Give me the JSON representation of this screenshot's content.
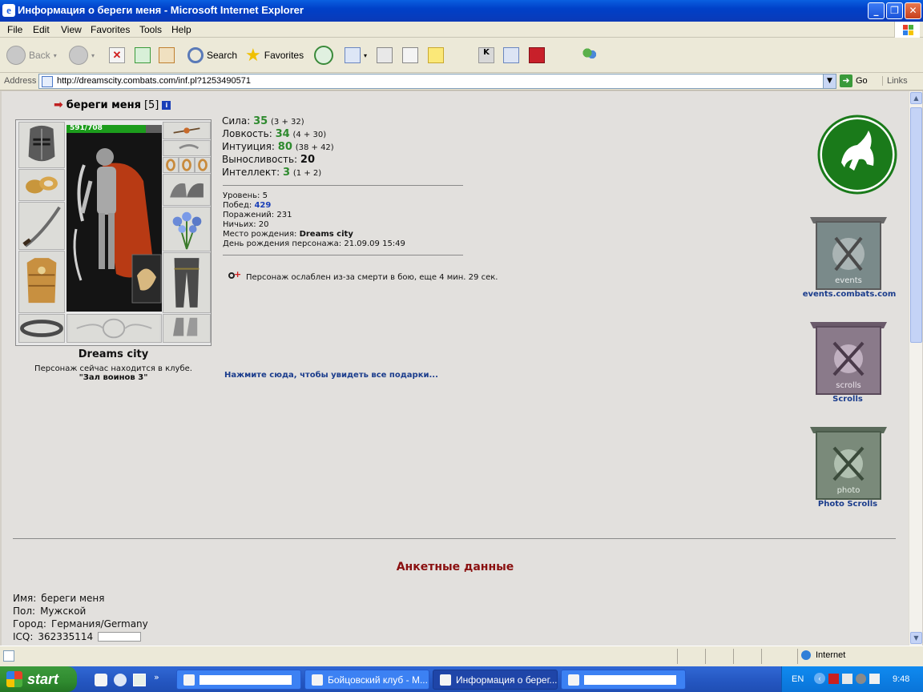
{
  "window": {
    "title": "Информация о береги меня - Microsoft Internet Explorer",
    "minimize": "_",
    "maximize": "❐",
    "close": "✕"
  },
  "menu": [
    "File",
    "Edit",
    "View",
    "Favorites",
    "Tools",
    "Help"
  ],
  "toolbar": {
    "back": "Back",
    "search": "Search",
    "favorites": "Favorites"
  },
  "address": {
    "label": "Address",
    "url": "http://dreamscity.combats.com/inf.pl?1253490571",
    "go": "Go",
    "links": "Links"
  },
  "character": {
    "name": "береги меня",
    "level": "[5]",
    "hp_text": "591/708",
    "hp_fraction": 0.835,
    "city": "Dreams city",
    "location_line": "Персонаж сейчас находится в клубе.",
    "location_room": "\"Зал воинов 3\""
  },
  "stats": [
    {
      "label": "Сила:",
      "value": "35",
      "detail": "(3 + 32)"
    },
    {
      "label": "Ловкость:",
      "value": "34",
      "detail": "(4 + 30)"
    },
    {
      "label": "Интуиция:",
      "value": "80",
      "detail": "(38 + 42)"
    },
    {
      "label": "Выносливость:",
      "value": "20",
      "detail": ""
    },
    {
      "label": "Интеллект:",
      "value": "3",
      "detail": "(1 + 2)"
    }
  ],
  "details": {
    "level_label": "Уровень:",
    "level": "5",
    "wins_label": "Побед:",
    "wins": "429",
    "losses_label": "Поражений:",
    "losses": "231",
    "draws_label": "Ничьих:",
    "draws": "20",
    "birthplace_label": "Место рождения:",
    "birthplace": "Dreams city",
    "birthday_label": "День рождения персонажа:",
    "birthday": "21.09.09 15:49"
  },
  "weakness": "Персонаж ослаблен из-за смерти в бою, еще 4 мин. 29 сек.",
  "gifts_link": "Нажмите сюда, чтобы увидеть все подарки...",
  "side": {
    "events_label": "events.combats.com",
    "events_banner": "events",
    "scrolls_label": "Scrolls",
    "scrolls_banner": "scrolls",
    "photo_label": "Photo Scrolls",
    "photo_banner": "photo"
  },
  "profile": {
    "heading": "Анкетные данные",
    "name_label": "Имя:",
    "name": "береги меня",
    "gender_label": "Пол:",
    "gender": "Мужской",
    "city_label": "Город:",
    "city": "Германия/Germany",
    "icq_label": "ICQ:",
    "icq": "362335114"
  },
  "status": {
    "zone": "Internet"
  },
  "taskbar": {
    "start": "start",
    "items": [
      "",
      "Бойцовский клуб - M...",
      "Информация о берег...",
      ""
    ],
    "lang": "EN",
    "clock": "9:48"
  },
  "colors": {
    "stat_green": "#2e8a2e",
    "link_blue": "#1a3c8c",
    "heading_red": "#8a1010",
    "goat_green": "#1a7a1a"
  }
}
